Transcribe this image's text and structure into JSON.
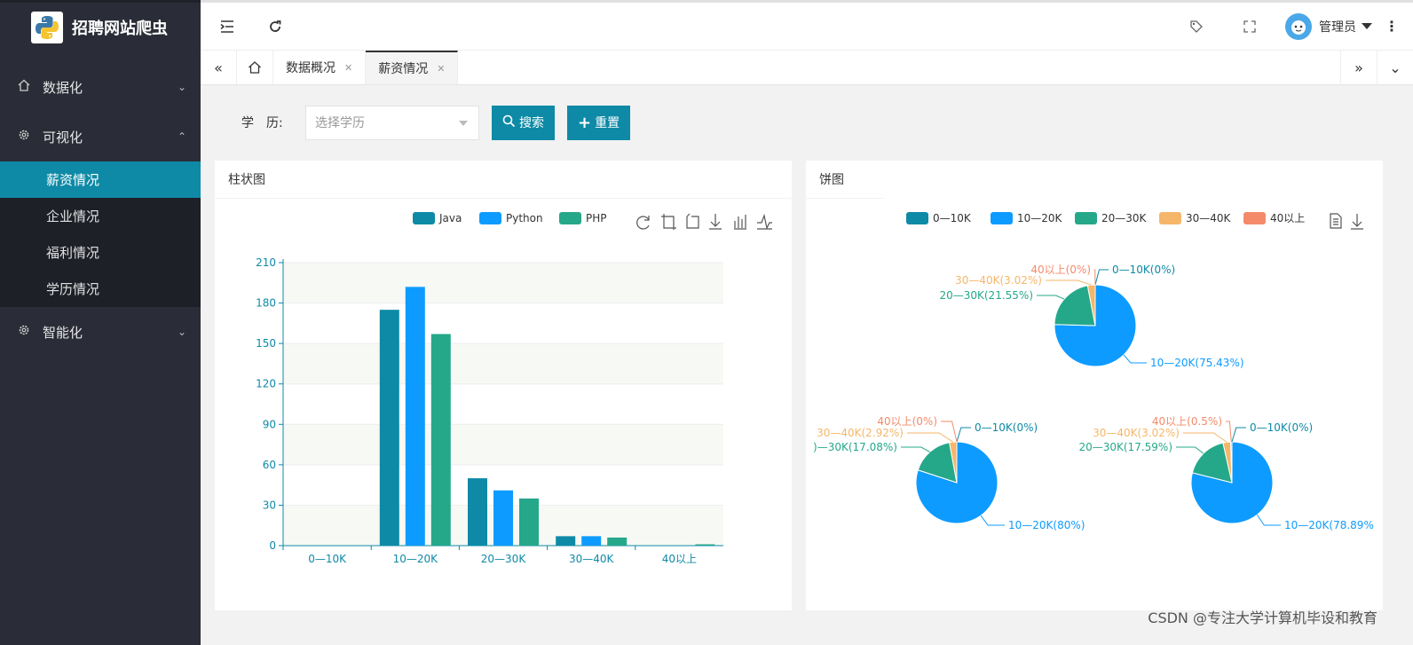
{
  "app": {
    "title": "招聘网站爬虫"
  },
  "sidebar": {
    "groups": [
      {
        "label": "数据化",
        "icon": "home-icon",
        "expanded": false
      },
      {
        "label": "可视化",
        "icon": "gear-icon",
        "expanded": true
      },
      {
        "label": "智能化",
        "icon": "gear-icon",
        "expanded": false
      }
    ],
    "sub_items": [
      {
        "label": "薪资情况",
        "active": true
      },
      {
        "label": "企业情况",
        "active": false
      },
      {
        "label": "福利情况",
        "active": false
      },
      {
        "label": "学历情况",
        "active": false
      }
    ]
  },
  "header": {
    "user": "管理员"
  },
  "tabs": [
    {
      "label": "数据概况",
      "active": false
    },
    {
      "label": "薪资情况",
      "active": true
    }
  ],
  "search": {
    "label": "学　历:",
    "placeholder": "选择学历",
    "search_button": "搜索",
    "reset_button": "重置"
  },
  "colors": {
    "accent": "#0e8aa6",
    "java": "#0e8aa6",
    "python": "#0e9bff",
    "php": "#25a88a",
    "c4": "#f5b66a",
    "c5": "#f58a6a"
  },
  "bar_card": {
    "title": "柱状图"
  },
  "pie_card": {
    "title": "饼图"
  },
  "chart_data": [
    {
      "type": "bar",
      "categories": [
        "0—10K",
        "10—20K",
        "20—30K",
        "30—40K",
        "40以上"
      ],
      "series": [
        {
          "name": "Java",
          "values": [
            0,
            175,
            50,
            7,
            0
          ]
        },
        {
          "name": "Python",
          "values": [
            0,
            192,
            41,
            7,
            0
          ]
        },
        {
          "name": "PHP",
          "values": [
            0,
            157,
            35,
            6,
            1
          ]
        }
      ],
      "yticks": [
        "0",
        "30",
        "60",
        "90",
        "120",
        "150",
        "180",
        "210"
      ],
      "ylim": [
        0,
        210
      ],
      "legend": "top-right"
    },
    {
      "type": "pie",
      "legend_labels": [
        "0—10K",
        "10—20K",
        "20—30K",
        "30—40K",
        "40以上"
      ],
      "pies": [
        {
          "values": [
            0,
            75.43,
            21.55,
            3.02,
            0
          ],
          "labels": [
            "0—10K(0%)",
            "10—20K(75.43%)",
            "20—30K(21.55%)",
            "30—40K(3.02%)",
            "40以上(0%)"
          ]
        },
        {
          "values": [
            0,
            80,
            17.08,
            2.92,
            0
          ],
          "labels": [
            "0—10K(0%)",
            "10—20K(80%)",
            ")—30K(17.08%)",
            "30—40K(2.92%)",
            "40以上(0%)"
          ]
        },
        {
          "values": [
            0,
            78.89,
            17.59,
            3.02,
            0.5
          ],
          "labels": [
            "0—10K(0%)",
            "10—20K(78.89%",
            "20—30K(17.59%)",
            "30—40K(3.02%)",
            "40以上(0.5%)"
          ]
        }
      ],
      "legend": "top-right"
    }
  ],
  "watermark": "CSDN @专注大学计算机毕设和教育"
}
